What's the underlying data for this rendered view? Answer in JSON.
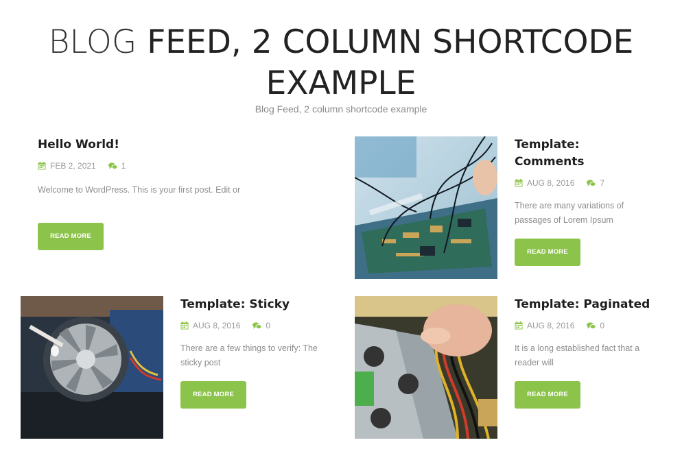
{
  "header": {
    "title_light": "BLOG",
    "title_rest": "FEED, 2 COLUMN SHORTCODE",
    "title_line2": "EXAMPLE",
    "subtitle": "Blog Feed, 2 column shortcode example"
  },
  "colors": {
    "accent": "#8cc34a",
    "meta_text": "#9a9a9a",
    "excerpt_text": "#8d8d8d"
  },
  "icons": {
    "date": "calendar-icon",
    "comments": "comment-icon"
  },
  "posts": [
    {
      "title": "Hello World!",
      "date": "FEB 2, 2021",
      "comments": "1",
      "excerpt": "Welcome to WordPress. This is your first post. Edit or",
      "button": "READ MORE"
    },
    {
      "title_line1": "Template:",
      "title_line2": "Comments",
      "date": "AUG 8, 2016",
      "comments": "7",
      "excerpt_line1": "There are many variations of",
      "excerpt_line2": "passages of Lorem Ipsum",
      "button": "READ MORE"
    },
    {
      "title": "Template: Sticky",
      "date": "AUG 8, 2016",
      "comments": "0",
      "excerpt_line1": "There are a few things to verify: The",
      "excerpt_line2": "sticky post",
      "button": "READ MORE"
    },
    {
      "title": "Template: Paginated",
      "date": "AUG 8, 2016",
      "comments": "0",
      "excerpt_line1": "It is a long established fact that a",
      "excerpt_line2": "reader will",
      "button": "READ MORE"
    }
  ]
}
